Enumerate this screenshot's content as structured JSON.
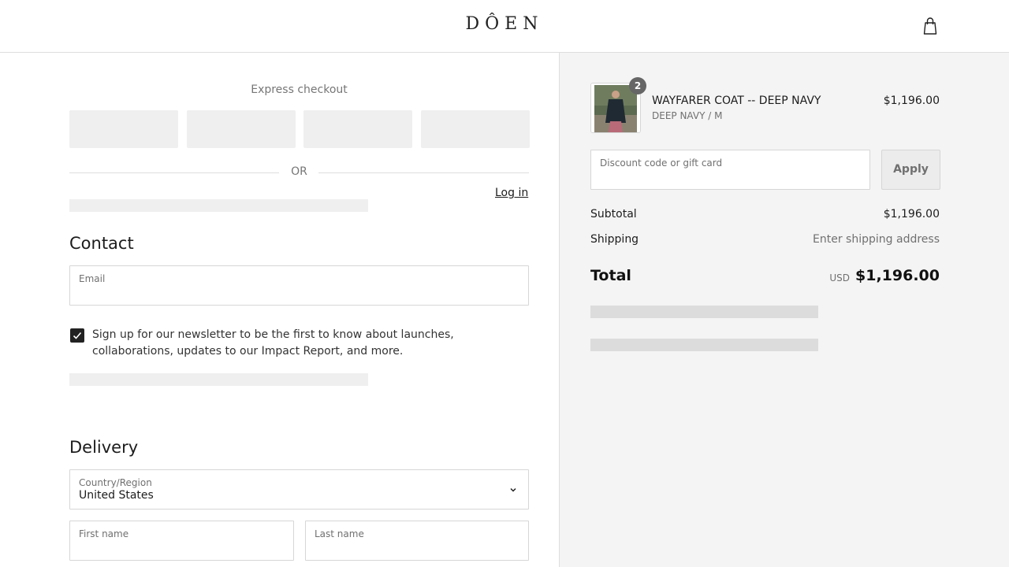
{
  "header": {
    "logo_text": "DÔEN",
    "cart_icon": "shopping-bag-icon"
  },
  "express": {
    "title": "Express checkout",
    "or_label": "OR"
  },
  "contact": {
    "title": "Contact",
    "login_label": "Log in",
    "email_label": "Email",
    "newsletter_checked": true,
    "newsletter_text": "Sign up for our newsletter to be the first to know about launches, collaborations, updates to our Impact Report, and more."
  },
  "delivery": {
    "title": "Delivery",
    "country_label": "Country/Region",
    "country_value": "United States",
    "first_name_label": "First name",
    "last_name_label": "Last name"
  },
  "order": {
    "item": {
      "name": "WAYFARER COAT -- DEEP NAVY",
      "variant": "DEEP NAVY / M",
      "price": "$1,196.00",
      "quantity": "2"
    },
    "discount_placeholder": "Discount code or gift card",
    "apply_label": "Apply",
    "subtotal_label": "Subtotal",
    "subtotal_value": "$1,196.00",
    "shipping_label": "Shipping",
    "shipping_value": "Enter shipping address",
    "total_label": "Total",
    "total_currency": "USD",
    "total_value": "$1,196.00"
  },
  "colors": {
    "checkbox": "#222222",
    "sidebar_bg": "#f4f4f4",
    "skeleton": "#efefef"
  }
}
